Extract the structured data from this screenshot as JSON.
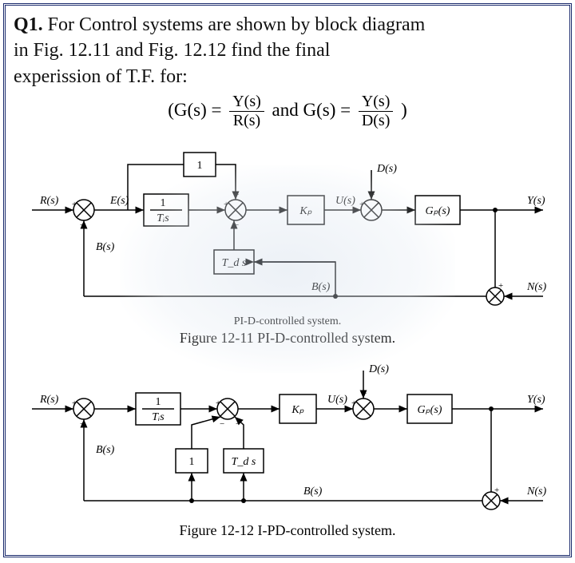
{
  "question": {
    "label": "Q1.",
    "text_line1": "For Control systems are shown by block diagram",
    "text_line2": "in Fig. 12.11 and Fig. 12.12 find the final",
    "text_line3": "experission of T.F. for:"
  },
  "formula": {
    "lead": "(G(s) =",
    "f1_num": "Y(s)",
    "f1_den": "R(s)",
    "mid": "and G(s) =",
    "f2_num": "Y(s)",
    "f2_den": "D(s)",
    "tail": ")"
  },
  "fig1": {
    "subcaption": "PI-D-controlled system.",
    "caption": "Figure 12-11 PI-D-controlled system.",
    "signals": {
      "R": "R(s)",
      "E": "E(s)",
      "U": "U(s)",
      "D": "D(s)",
      "Y": "Y(s)",
      "B": "B(s)",
      "N": "N(s)",
      "Bfb": "B(s)"
    },
    "blocks": {
      "one": "1",
      "int_num": "1",
      "int_den": "Tᵢs",
      "Kp": "Kₚ",
      "Td": "T_d s",
      "Gp": "Gₚ(s)"
    }
  },
  "fig2": {
    "caption": "Figure 12-12 I-PD-controlled system.",
    "signals": {
      "R": "R(s)",
      "U": "U(s)",
      "D": "D(s)",
      "Y": "Y(s)",
      "B": "B(s)",
      "N": "N(s)",
      "Bfb": "B(s)"
    },
    "blocks": {
      "int_num": "1",
      "int_den": "Tᵢs",
      "Kp": "Kₚ",
      "one": "1",
      "Td": "T_d s",
      "Gp": "Gₚ(s)"
    }
  }
}
